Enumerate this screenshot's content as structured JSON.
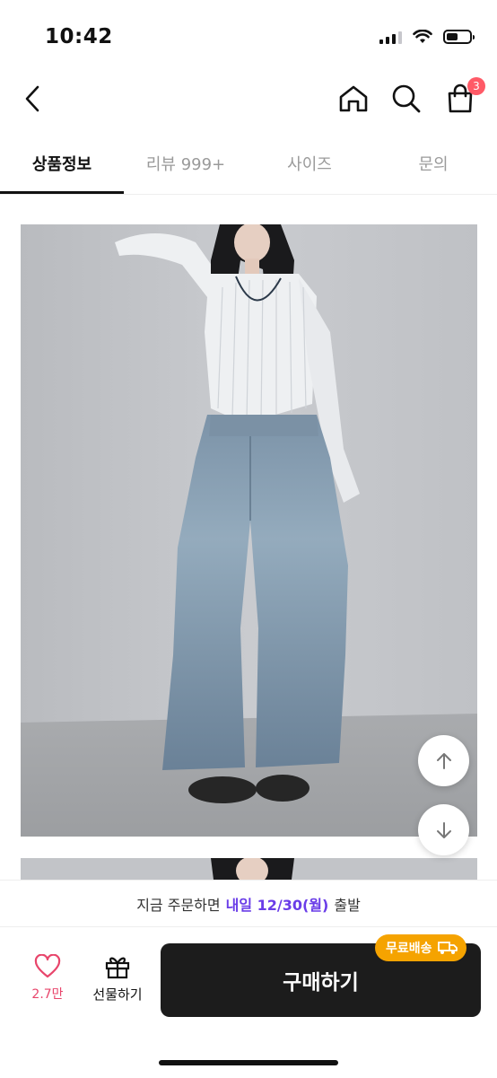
{
  "status_bar": {
    "time": "10:42"
  },
  "header": {
    "cart_count": "3"
  },
  "tabs": [
    {
      "label": "상품정보",
      "active": true
    },
    {
      "label": "리뷰 999+",
      "active": false
    },
    {
      "label": "사이즈",
      "active": false
    },
    {
      "label": "문의",
      "active": false
    }
  ],
  "shipping_notice": {
    "prefix": "지금 주문하면",
    "highlight": "내일 12/30(월)",
    "suffix": "출발"
  },
  "bottom_bar": {
    "like_count": "2.7만",
    "gift_label": "선물하기",
    "buy_label": "구매하기",
    "free_shipping_badge": "무료배송"
  },
  "colors": {
    "accent_purple": "#6a3de8",
    "badge_red": "#ff5a67",
    "like_pink": "#e8456b",
    "free_ship_orange": "#f5a300",
    "buy_button": "#1c1c1c"
  },
  "icons": {
    "back": "chevron-left-icon",
    "home": "home-icon",
    "search": "search-icon",
    "cart": "shopping-bag-icon",
    "scroll_up": "arrow-up-icon",
    "scroll_down": "arrow-down-icon",
    "like": "heart-icon",
    "gift": "gift-icon",
    "truck": "truck-icon"
  }
}
